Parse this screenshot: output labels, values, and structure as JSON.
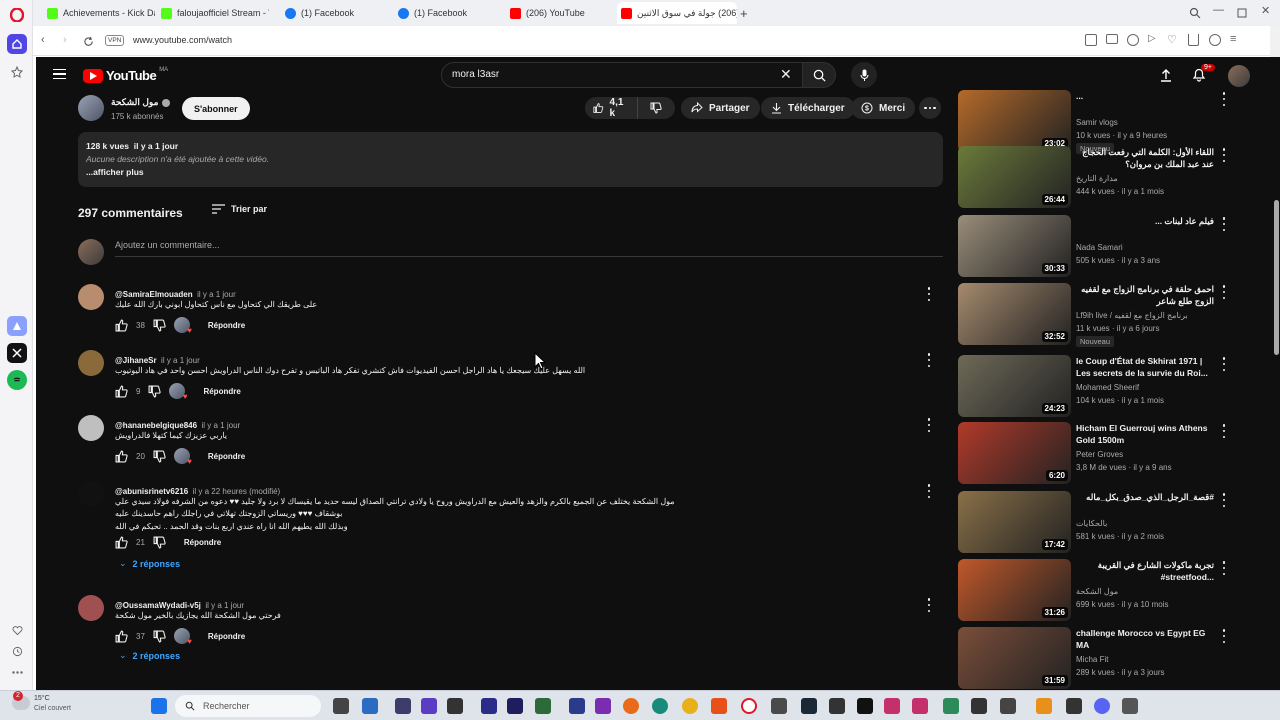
{
  "browser": {
    "tabs": [
      {
        "title": "Achievements - Kick Dash",
        "color": "#53fc18"
      },
      {
        "title": "faloujaofficiel Stream - Wa",
        "color": "#53fc18"
      },
      {
        "title": "(1) Facebook",
        "color": "#1877f2"
      },
      {
        "title": "(1) Facebook",
        "color": "#1877f2"
      },
      {
        "title": "(206) YouTube",
        "color": "#ff0000"
      },
      {
        "title": "(206) جولة في سوق الاثنين",
        "color": "#ff0000"
      }
    ],
    "vpn_label": "VPN",
    "url": "www.youtube.com/watch"
  },
  "youtube": {
    "logo_text": "YouTube",
    "logo_region": "MA",
    "search_value": "mora l3asr",
    "notif_count": "9+",
    "channel": {
      "name": "مول الشكحة",
      "subscribers": "175 k abonnés",
      "subscribe_label": "S'abonner"
    },
    "actions": {
      "likes": "4,1 k",
      "share": "Partager",
      "download": "Télécharger",
      "thanks": "Merci"
    },
    "description": {
      "stats": "128 k vues  il y a 1 jour",
      "text": "Aucune description n'a été ajoutée à cette vidéo.",
      "more": "...afficher plus"
    },
    "comments_header": {
      "count": "297 commentaires",
      "sort": "Trier par",
      "add_placeholder": "Ajoutez un commentaire..."
    },
    "comments": [
      {
        "user": "@SamiraElmouaden",
        "time": "il y a 1 jour",
        "text": "على طريقك الي كتحاول مع ناس كتحاول ابوني بارك الله عليك",
        "likes": "38",
        "reply": "Répondre",
        "color": "#b88c6f"
      },
      {
        "user": "@JihaneSr",
        "time": "il y a 1 jour",
        "text": "الله يسهل عليك سيجعك يا هاد الراجل احسن الفيديوات فاش كتشري تفكر هاد الباتيس و تفرح دوك الناس الدراويش احسن واحد في هاد اليوتيوب",
        "likes": "9",
        "reply": "Répondre",
        "color": "#8a6a3a"
      },
      {
        "user": "@hananebelgique846",
        "time": "il y a 1 jour",
        "text": "ياربي عزيزك كيما كتهلا فالدراويش",
        "likes": "20",
        "reply": "Répondre",
        "color": "#bfbfbf"
      },
      {
        "user": "@abunisrinetv6216",
        "time": "il y a 22 heures (modifié)",
        "text": "مول الشكحة يختلف عن الجميع بالكرم والزهد والعيش مع الدراويش وروح يا ولادي ترانتي الصداق ليسه حديد ما يقيساك لا برد ولا جليد ♥♥ دعوه من الشرفه فولاد سيدي علي بوشقاف ♥♥♥ وريساتي الزوجتك تهلاتي في راجلك راهم حاسدينك عليه",
        "text2": "وبذلك الله يطيهم الله انا راه عندي اربع بنات وقد الحمد .. تحيكم في الله",
        "likes": "21",
        "reply": "Répondre",
        "replies": "2 réponses",
        "color": "#111111"
      },
      {
        "user": "@OussamaWydadi-v5j",
        "time": "il y a 1 jour",
        "text": "فرحتي مول الشكحة الله يجازيك بالخير مول شكحة",
        "likes": "37",
        "reply": "Répondre",
        "replies": "2 réponses",
        "color": "#a05050"
      }
    ],
    "sidebar": [
      {
        "title": "...",
        "channel": "Samir vlogs",
        "meta": "10 k vues · il y a 9 heures",
        "badge": "Nouveau",
        "duration": "23:02",
        "thumb": "#b46a2a"
      },
      {
        "title": "اللقاء الأول: الكلمة التي رفعت الحجاج عند عبد الملك بن مروان؟",
        "channel": "مدارة التاريخ",
        "meta": "444 k vues · il y a 1 mois",
        "badge": "",
        "duration": "26:44",
        "thumb": "#6b7a3a"
      },
      {
        "title": "فيلم عاد لبنات ...",
        "channel": "Nada Samari",
        "meta": "505 k vues · il y a 3 ans",
        "badge": "",
        "duration": "30:33",
        "thumb": "#9a8d7a"
      },
      {
        "title": "احمق حلقة في برنامج الزواج مع لقفيه الزوج طلع شاعر",
        "channel": "Lf9ih live / برنامج الزواج مع لقفيه",
        "meta": "11 k vues · il y a 6 jours",
        "badge": "Nouveau",
        "duration": "32:52",
        "thumb": "#a58a6e"
      },
      {
        "title": "le Coup d'État de Skhirat 1971 | Les secrets de la survie du Roi...",
        "channel": "Mohamed Sheerif",
        "meta": "104 k vues · il y a 1 mois",
        "badge": "",
        "duration": "24:23",
        "thumb": "#6e6a58"
      },
      {
        "title": "Hicham El Guerrouj wins Athens Gold 1500m",
        "channel": "Peter Groves",
        "meta": "3,8 M de vues · il y a 9 ans",
        "badge": "",
        "duration": "6:20",
        "thumb": "#b23a2a"
      },
      {
        "title": "#قصة_الرجل_الذي_صدق_بكل_ماله",
        "channel": "بالحكايات",
        "meta": "581 k vues · il y a 2 mois",
        "badge": "",
        "duration": "17:42",
        "thumb": "#8a7048"
      },
      {
        "title": "تجربة ماكولات الشارع في القريبة ...streetfood#",
        "channel": "مول الشكحة",
        "meta": "699 k vues · il y a 10 mois",
        "badge": "",
        "duration": "31:26",
        "thumb": "#c0582a"
      },
      {
        "title": "challenge Morocco vs Egypt EG MA",
        "channel": "Micha Fit",
        "meta": "289 k vues · il y a 3 jours",
        "badge": "",
        "duration": "31:59",
        "thumb": "#7a4e3a"
      }
    ]
  },
  "taskbar": {
    "search_placeholder": "Rechercher",
    "weather_temp": "15°C",
    "weather_text": "Ciel couvert"
  }
}
